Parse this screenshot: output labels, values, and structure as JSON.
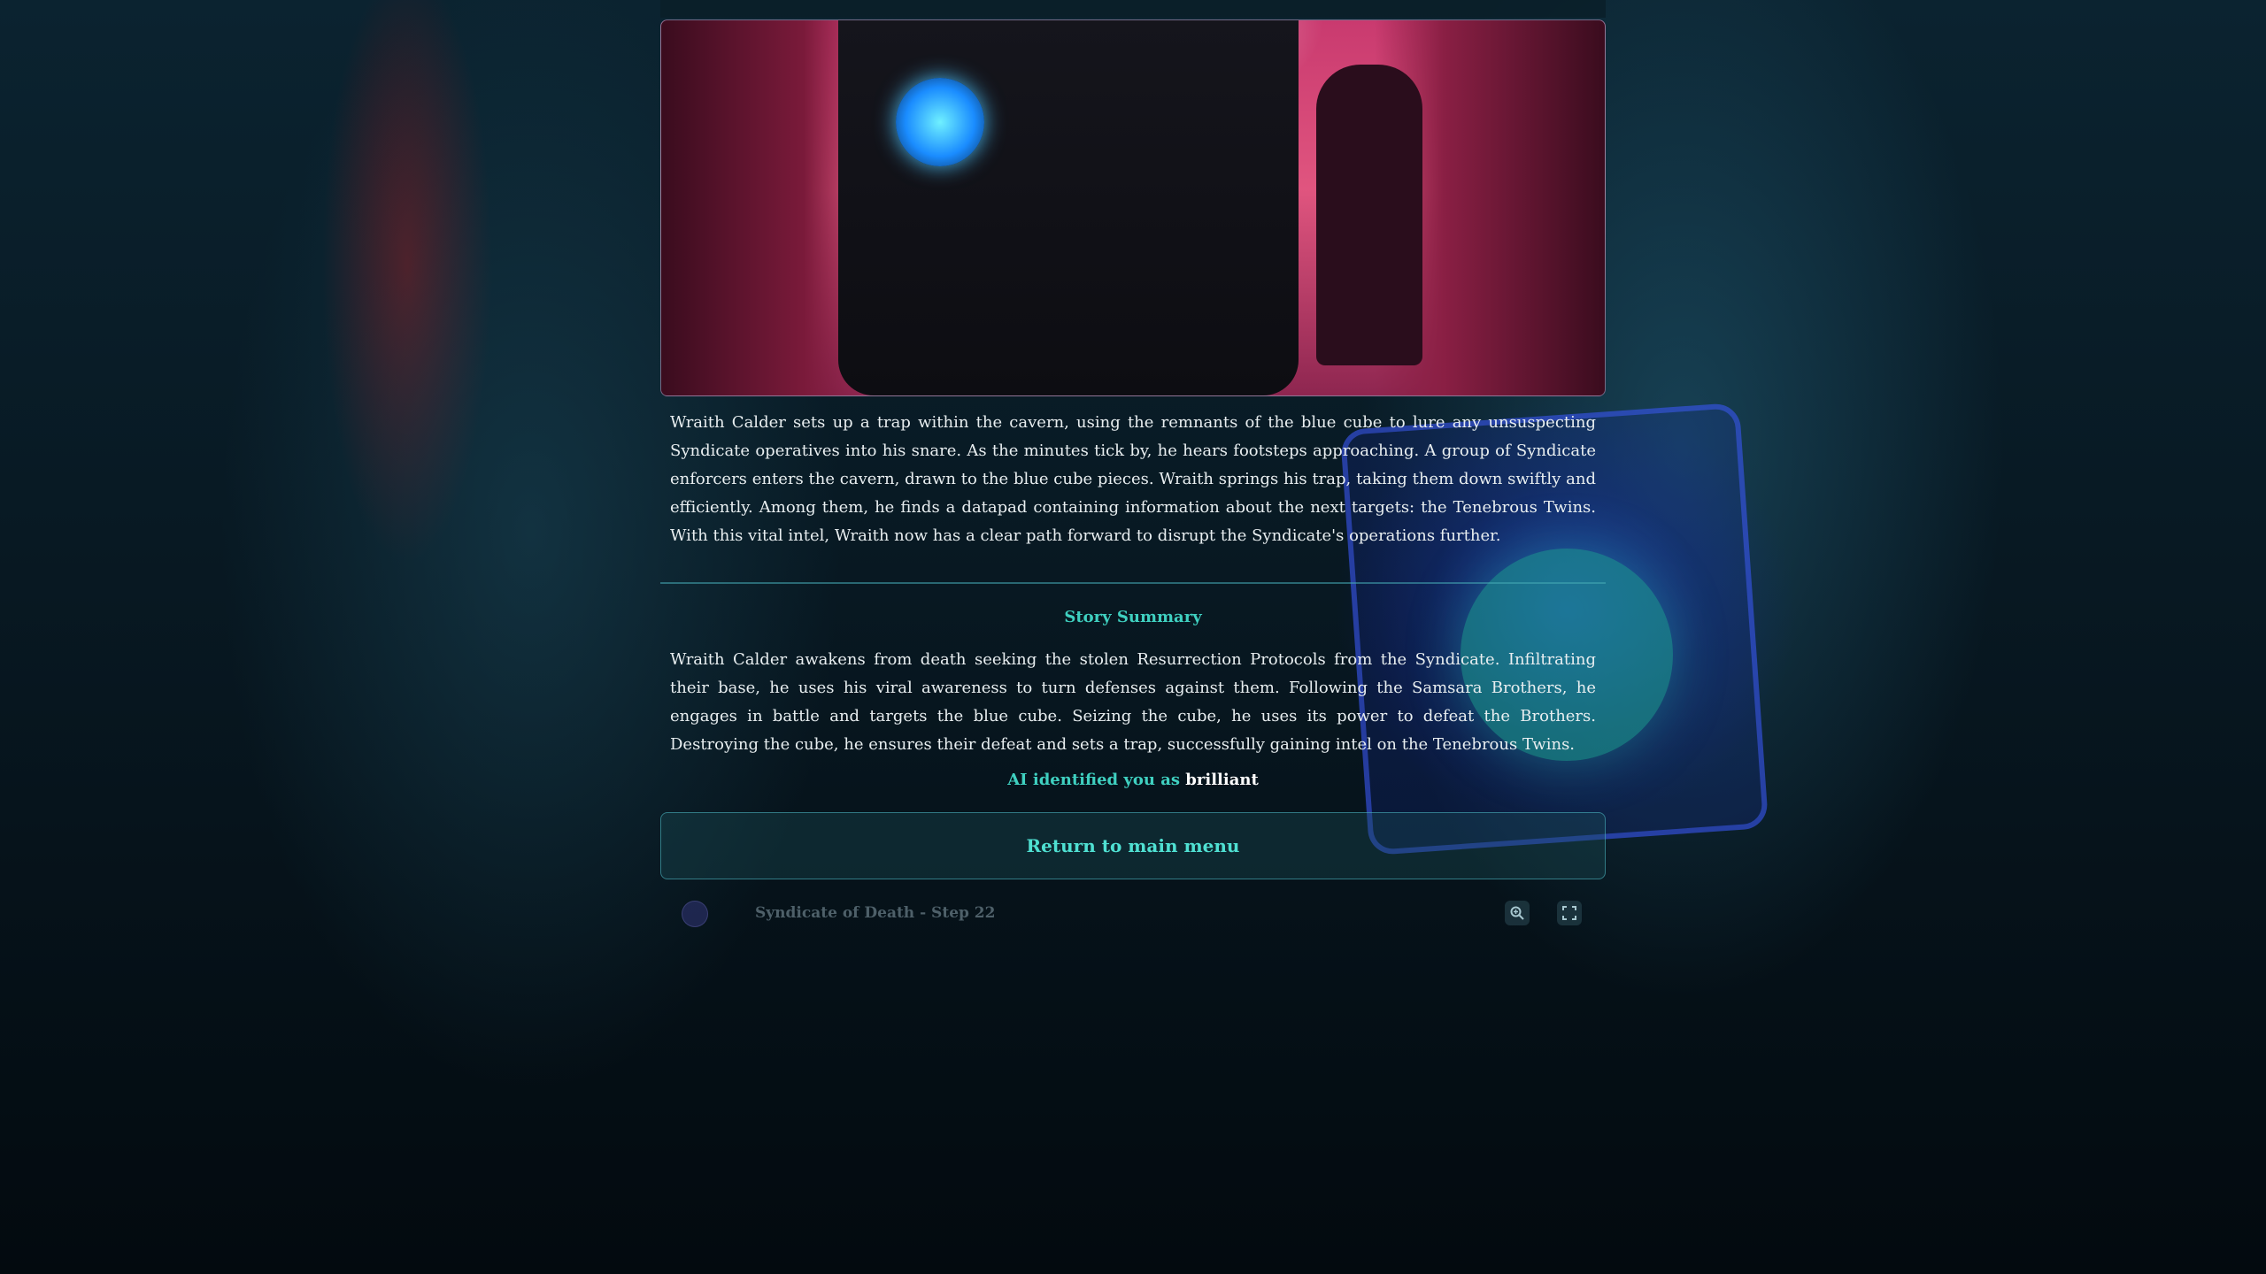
{
  "narrative": "Wraith Calder sets up a trap within the cavern, using the remnants of the blue cube to lure any unsuspecting Syndicate operatives into his snare. As the minutes tick by, he hears footsteps approaching. A group of Syndicate enforcers enters the cavern, drawn to the blue cube pieces. Wraith springs his trap, taking them down swiftly and efficiently. Among them, he finds a datapad containing information about the next targets: the Tenebrous Twins. With this vital intel, Wraith now has a clear path forward to disrupt the Syndicate's operations further.",
  "summary": {
    "title": "Story Summary",
    "text": "Wraith Calder awakens from death seeking the stolen Resurrection Protocols from the Syndicate. Infiltrating their base, he uses his viral awareness to turn defenses against them. Following the Samsara Brothers, he engages in battle and targets the blue cube. Seizing the cube, he uses its power to defeat the Brothers. Destroying the cube, he ensures their defeat and sets a trap, successfully gaining intel on the Tenebrous Twins."
  },
  "ai_identification": {
    "prefix": "AI identified you as",
    "trait": "brilliant"
  },
  "return_button_label": "Return to main menu",
  "footer": {
    "step_label": "Syndicate of Death - Step 22",
    "zoom_icon": "zoom-in-icon",
    "fullscreen_icon": "fullscreen-icon"
  },
  "colors": {
    "accent": "#3fd0c0",
    "text": "#e8eef0"
  }
}
